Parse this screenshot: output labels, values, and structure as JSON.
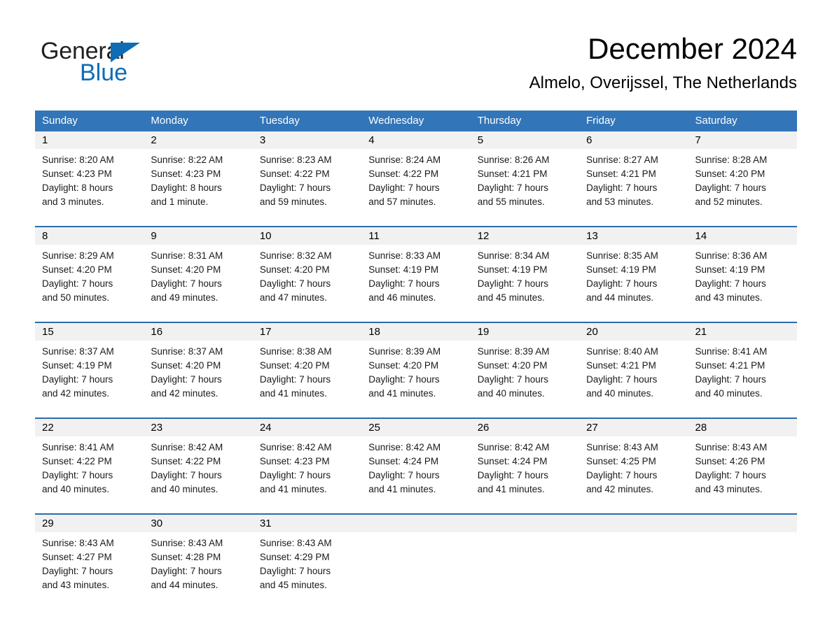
{
  "brand": {
    "name_part1": "General",
    "name_part2": "Blue",
    "accent_color": "#0f6cb5"
  },
  "header": {
    "title": "December 2024",
    "subtitle": "Almelo, Overijssel, The Netherlands"
  },
  "theme": {
    "header_row_bg": "#3275b8",
    "date_band_bg": "#f1f1f1",
    "separator_color": "#2b6ca8"
  },
  "weekdays": [
    "Sunday",
    "Monday",
    "Tuesday",
    "Wednesday",
    "Thursday",
    "Friday",
    "Saturday"
  ],
  "weeks": [
    {
      "days": [
        {
          "date": "1",
          "sunrise": "Sunrise: 8:20 AM",
          "sunset": "Sunset: 4:23 PM",
          "daylight1": "Daylight: 8 hours",
          "daylight2": "and 3 minutes."
        },
        {
          "date": "2",
          "sunrise": "Sunrise: 8:22 AM",
          "sunset": "Sunset: 4:23 PM",
          "daylight1": "Daylight: 8 hours",
          "daylight2": "and 1 minute."
        },
        {
          "date": "3",
          "sunrise": "Sunrise: 8:23 AM",
          "sunset": "Sunset: 4:22 PM",
          "daylight1": "Daylight: 7 hours",
          "daylight2": "and 59 minutes."
        },
        {
          "date": "4",
          "sunrise": "Sunrise: 8:24 AM",
          "sunset": "Sunset: 4:22 PM",
          "daylight1": "Daylight: 7 hours",
          "daylight2": "and 57 minutes."
        },
        {
          "date": "5",
          "sunrise": "Sunrise: 8:26 AM",
          "sunset": "Sunset: 4:21 PM",
          "daylight1": "Daylight: 7 hours",
          "daylight2": "and 55 minutes."
        },
        {
          "date": "6",
          "sunrise": "Sunrise: 8:27 AM",
          "sunset": "Sunset: 4:21 PM",
          "daylight1": "Daylight: 7 hours",
          "daylight2": "and 53 minutes."
        },
        {
          "date": "7",
          "sunrise": "Sunrise: 8:28 AM",
          "sunset": "Sunset: 4:20 PM",
          "daylight1": "Daylight: 7 hours",
          "daylight2": "and 52 minutes."
        }
      ]
    },
    {
      "days": [
        {
          "date": "8",
          "sunrise": "Sunrise: 8:29 AM",
          "sunset": "Sunset: 4:20 PM",
          "daylight1": "Daylight: 7 hours",
          "daylight2": "and 50 minutes."
        },
        {
          "date": "9",
          "sunrise": "Sunrise: 8:31 AM",
          "sunset": "Sunset: 4:20 PM",
          "daylight1": "Daylight: 7 hours",
          "daylight2": "and 49 minutes."
        },
        {
          "date": "10",
          "sunrise": "Sunrise: 8:32 AM",
          "sunset": "Sunset: 4:20 PM",
          "daylight1": "Daylight: 7 hours",
          "daylight2": "and 47 minutes."
        },
        {
          "date": "11",
          "sunrise": "Sunrise: 8:33 AM",
          "sunset": "Sunset: 4:19 PM",
          "daylight1": "Daylight: 7 hours",
          "daylight2": "and 46 minutes."
        },
        {
          "date": "12",
          "sunrise": "Sunrise: 8:34 AM",
          "sunset": "Sunset: 4:19 PM",
          "daylight1": "Daylight: 7 hours",
          "daylight2": "and 45 minutes."
        },
        {
          "date": "13",
          "sunrise": "Sunrise: 8:35 AM",
          "sunset": "Sunset: 4:19 PM",
          "daylight1": "Daylight: 7 hours",
          "daylight2": "and 44 minutes."
        },
        {
          "date": "14",
          "sunrise": "Sunrise: 8:36 AM",
          "sunset": "Sunset: 4:19 PM",
          "daylight1": "Daylight: 7 hours",
          "daylight2": "and 43 minutes."
        }
      ]
    },
    {
      "days": [
        {
          "date": "15",
          "sunrise": "Sunrise: 8:37 AM",
          "sunset": "Sunset: 4:19 PM",
          "daylight1": "Daylight: 7 hours",
          "daylight2": "and 42 minutes."
        },
        {
          "date": "16",
          "sunrise": "Sunrise: 8:37 AM",
          "sunset": "Sunset: 4:20 PM",
          "daylight1": "Daylight: 7 hours",
          "daylight2": "and 42 minutes."
        },
        {
          "date": "17",
          "sunrise": "Sunrise: 8:38 AM",
          "sunset": "Sunset: 4:20 PM",
          "daylight1": "Daylight: 7 hours",
          "daylight2": "and 41 minutes."
        },
        {
          "date": "18",
          "sunrise": "Sunrise: 8:39 AM",
          "sunset": "Sunset: 4:20 PM",
          "daylight1": "Daylight: 7 hours",
          "daylight2": "and 41 minutes."
        },
        {
          "date": "19",
          "sunrise": "Sunrise: 8:39 AM",
          "sunset": "Sunset: 4:20 PM",
          "daylight1": "Daylight: 7 hours",
          "daylight2": "and 40 minutes."
        },
        {
          "date": "20",
          "sunrise": "Sunrise: 8:40 AM",
          "sunset": "Sunset: 4:21 PM",
          "daylight1": "Daylight: 7 hours",
          "daylight2": "and 40 minutes."
        },
        {
          "date": "21",
          "sunrise": "Sunrise: 8:41 AM",
          "sunset": "Sunset: 4:21 PM",
          "daylight1": "Daylight: 7 hours",
          "daylight2": "and 40 minutes."
        }
      ]
    },
    {
      "days": [
        {
          "date": "22",
          "sunrise": "Sunrise: 8:41 AM",
          "sunset": "Sunset: 4:22 PM",
          "daylight1": "Daylight: 7 hours",
          "daylight2": "and 40 minutes."
        },
        {
          "date": "23",
          "sunrise": "Sunrise: 8:42 AM",
          "sunset": "Sunset: 4:22 PM",
          "daylight1": "Daylight: 7 hours",
          "daylight2": "and 40 minutes."
        },
        {
          "date": "24",
          "sunrise": "Sunrise: 8:42 AM",
          "sunset": "Sunset: 4:23 PM",
          "daylight1": "Daylight: 7 hours",
          "daylight2": "and 41 minutes."
        },
        {
          "date": "25",
          "sunrise": "Sunrise: 8:42 AM",
          "sunset": "Sunset: 4:24 PM",
          "daylight1": "Daylight: 7 hours",
          "daylight2": "and 41 minutes."
        },
        {
          "date": "26",
          "sunrise": "Sunrise: 8:42 AM",
          "sunset": "Sunset: 4:24 PM",
          "daylight1": "Daylight: 7 hours",
          "daylight2": "and 41 minutes."
        },
        {
          "date": "27",
          "sunrise": "Sunrise: 8:43 AM",
          "sunset": "Sunset: 4:25 PM",
          "daylight1": "Daylight: 7 hours",
          "daylight2": "and 42 minutes."
        },
        {
          "date": "28",
          "sunrise": "Sunrise: 8:43 AM",
          "sunset": "Sunset: 4:26 PM",
          "daylight1": "Daylight: 7 hours",
          "daylight2": "and 43 minutes."
        }
      ]
    },
    {
      "days": [
        {
          "date": "29",
          "sunrise": "Sunrise: 8:43 AM",
          "sunset": "Sunset: 4:27 PM",
          "daylight1": "Daylight: 7 hours",
          "daylight2": "and 43 minutes."
        },
        {
          "date": "30",
          "sunrise": "Sunrise: 8:43 AM",
          "sunset": "Sunset: 4:28 PM",
          "daylight1": "Daylight: 7 hours",
          "daylight2": "and 44 minutes."
        },
        {
          "date": "31",
          "sunrise": "Sunrise: 8:43 AM",
          "sunset": "Sunset: 4:29 PM",
          "daylight1": "Daylight: 7 hours",
          "daylight2": "and 45 minutes."
        },
        {
          "date": "",
          "sunrise": "",
          "sunset": "",
          "daylight1": "",
          "daylight2": ""
        },
        {
          "date": "",
          "sunrise": "",
          "sunset": "",
          "daylight1": "",
          "daylight2": ""
        },
        {
          "date": "",
          "sunrise": "",
          "sunset": "",
          "daylight1": "",
          "daylight2": ""
        },
        {
          "date": "",
          "sunrise": "",
          "sunset": "",
          "daylight1": "",
          "daylight2": ""
        }
      ]
    }
  ]
}
